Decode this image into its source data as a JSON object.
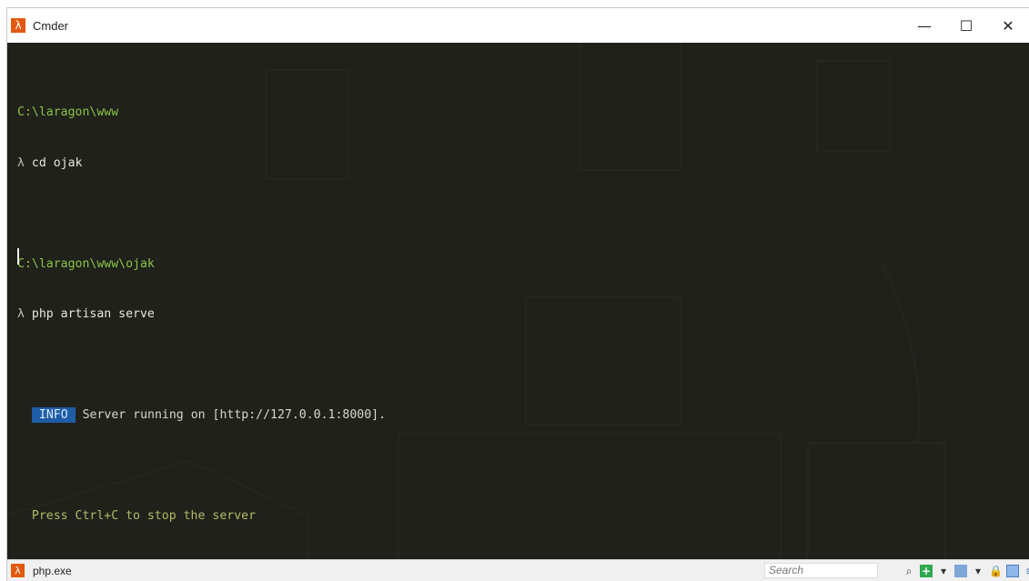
{
  "window": {
    "title": "Cmder",
    "app_icon_glyph": "λ",
    "buttons": {
      "minimize": "—",
      "maximize": "☐",
      "close": "✕"
    }
  },
  "terminal": {
    "lines": [
      {
        "type": "path",
        "text": "C:\\laragon\\www"
      },
      {
        "type": "command",
        "prompt": "λ ",
        "text": "cd ojak"
      },
      {
        "type": "blank"
      },
      {
        "type": "path",
        "text": "C:\\laragon\\www\\ojak"
      },
      {
        "type": "command",
        "prompt": "λ ",
        "text": "php artisan serve"
      },
      {
        "type": "blank"
      },
      {
        "type": "info",
        "badge": "INFO",
        "text": " Server running on [http://127.0.0.1:8000]."
      },
      {
        "type": "blank"
      },
      {
        "type": "hint",
        "text": "Press Ctrl+C to stop the server"
      }
    ]
  },
  "statusbar": {
    "tab_label": "php.exe",
    "tab_icon_glyph": "λ",
    "search_placeholder": "Search",
    "tools": [
      {
        "name": "search-icon",
        "glyph": "⌕"
      },
      {
        "name": "new-console-icon",
        "glyph": "+"
      },
      {
        "name": "dropdown-icon",
        "glyph": "▾"
      },
      {
        "name": "split-icon",
        "glyph": ""
      },
      {
        "name": "dropdown-icon",
        "glyph": "▾"
      },
      {
        "name": "lock-icon",
        "glyph": "🔒"
      },
      {
        "name": "panel-icon",
        "glyph": ""
      },
      {
        "name": "menu-icon",
        "glyph": "≡"
      }
    ]
  },
  "colors": {
    "path": "#8bc34a",
    "info_badge_bg": "#1e5da6",
    "hint": "#b5b96a",
    "terminal_bg": "#1f211c"
  }
}
